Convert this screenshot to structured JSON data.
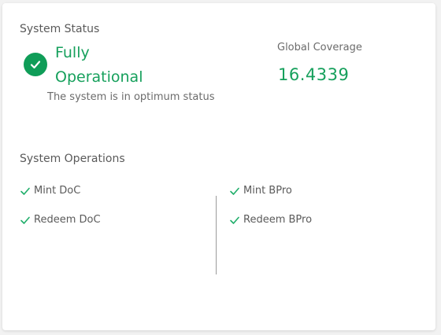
{
  "status": {
    "section_title": "System Status",
    "headline_line1": "Fully",
    "headline_line2": "Operational",
    "description": "The system is in optimum status",
    "icon": "check-circle-icon",
    "color": "#0f9d58"
  },
  "coverage": {
    "label": "Global Coverage",
    "value": "16.4339"
  },
  "operations": {
    "section_title": "System Operations",
    "left": [
      {
        "label": "Mint DoC",
        "icon": "check-icon"
      },
      {
        "label": "Redeem DoC",
        "icon": "check-icon"
      }
    ],
    "right": [
      {
        "label": "Mint BPro",
        "icon": "check-icon"
      },
      {
        "label": "Redeem BPro",
        "icon": "check-icon"
      }
    ],
    "check_color": "#1fae6a"
  }
}
